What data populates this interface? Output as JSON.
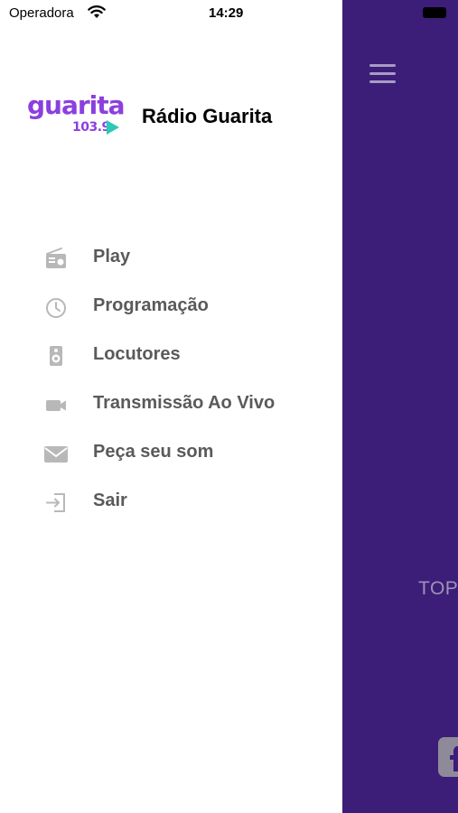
{
  "status_bar": {
    "carrier": "Operadora",
    "time": "14:29"
  },
  "header": {
    "logo_word": "guarita",
    "logo_frequency": "103.9",
    "title": "Rádio Guarita"
  },
  "menu": {
    "items": [
      {
        "label": "Play",
        "icon": "radio-icon"
      },
      {
        "label": "Programação",
        "icon": "clock-icon"
      },
      {
        "label": "Locutores",
        "icon": "speaker-icon"
      },
      {
        "label": "Transmissão Ao Vivo",
        "icon": "video-camera-icon"
      },
      {
        "label": "Peça seu som",
        "icon": "envelope-icon"
      },
      {
        "label": "Sair",
        "icon": "sign-out-icon"
      }
    ]
  },
  "main": {
    "top_text": "TOP",
    "social_icon": "facebook-icon"
  },
  "colors": {
    "main_background": "#3c1d78",
    "brand_purple": "#8b3fe0",
    "brand_teal": "#2ec9b6",
    "menu_text": "#5a5a5a",
    "menu_icon": "#b8b8b8"
  }
}
